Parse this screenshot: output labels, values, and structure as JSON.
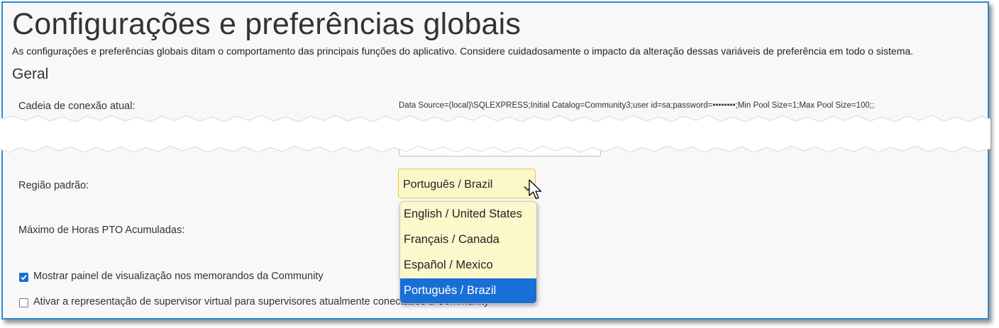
{
  "page": {
    "title": "Configurações e preferências globais",
    "description": "As configurações e preferências globais ditam o comportamento das principais funções do aplicativo. Considere cuidadosamente o impacto da alteração dessas variáveis de preferência em todo o sistema.",
    "section_title": "Geral"
  },
  "connection": {
    "label": "Cadeia de conexão atual:",
    "value": "Data Source=(local)\\SQLEXPRESS;Initial Catalog=Community3;user id=sa;password=••••••••;Min Pool Size=1;Max Pool Size=100;;"
  },
  "region": {
    "label": "Região padrão:",
    "selected": "Português / Brazil",
    "options": [
      "English / United States",
      "Français / Canada",
      "Español / Mexico",
      "Português / Brazil"
    ]
  },
  "pto": {
    "label": "Máximo de Horas PTO Acumuladas:"
  },
  "checkboxes": [
    {
      "label": "Mostrar painel de visualização nos memorandos da Community",
      "checked": true
    },
    {
      "label": "Ativar a representação de supervisor virtual para supervisores atualmente conectados à Community",
      "checked": false
    }
  ],
  "colors": {
    "frame_border": "#2a8ccf",
    "select_bg": "#fbf7c9",
    "select_border": "#e7c64a",
    "highlight": "#1a6fd6"
  },
  "icons": {
    "dropdown": "chevron-down-icon",
    "cursor": "mouse-pointer-icon",
    "check": "check-icon"
  }
}
